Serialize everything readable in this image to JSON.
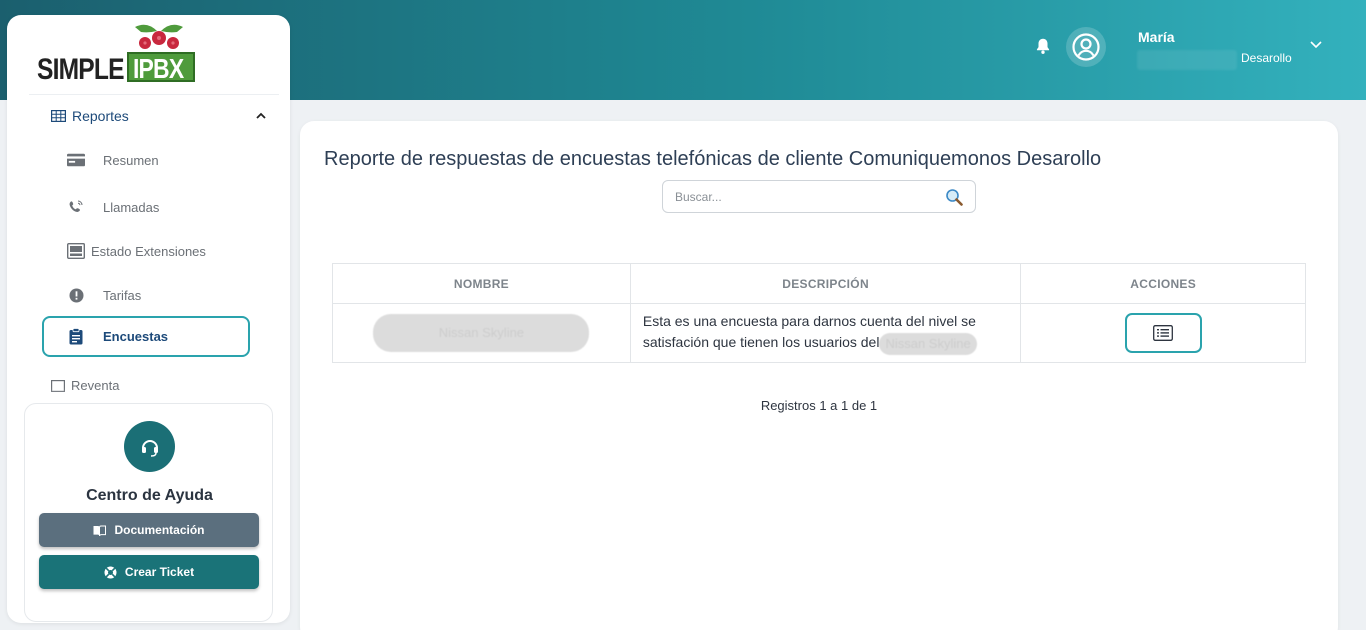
{
  "header": {
    "user_name": "María",
    "company": "Desarollo"
  },
  "logo": {
    "text_left": "SIMPLE",
    "text_right": "IPBX"
  },
  "sidebar": {
    "section": {
      "label": "Reportes",
      "icon": "table-icon"
    },
    "items": [
      {
        "label": "Resumen",
        "icon": "card-icon"
      },
      {
        "label": "Llamadas",
        "icon": "phone-icon"
      },
      {
        "label": "Estado Extensiones",
        "icon": "device-icon"
      },
      {
        "label": "Tarifas",
        "icon": "alert-icon"
      },
      {
        "label": "Encuestas",
        "icon": "clipboard-icon",
        "active": true
      }
    ],
    "next_section": {
      "label": "Reventa"
    }
  },
  "help": {
    "title": "Centro de Ayuda",
    "doc_button": "Documentación",
    "ticket_button": "Crear Ticket"
  },
  "main": {
    "title": "Reporte de respuestas de encuestas telefónicas de cliente Comuniquemonos Desarollo",
    "search": {
      "placeholder": "Buscar...",
      "value": ""
    },
    "table": {
      "columns": [
        "NOMBRE",
        "DESCRIPCIÓN",
        "ACCIONES"
      ],
      "rows": [
        {
          "name": "Nissan Skyline",
          "description_line1": "Esta es una encuesta para darnos cuenta del nivel se",
          "description_line2": "satisfación que tienen los usuarios del",
          "description_blurred": "Nissan Skyline"
        }
      ]
    },
    "records": "Registros 1 a 1 de 1"
  },
  "colors": {
    "accent": "#2aa3ad",
    "title": "#2e3f55",
    "nav_active": "#1d4a7a",
    "doc_button": "#5b6f7e",
    "ticket_button": "#1a7378"
  }
}
